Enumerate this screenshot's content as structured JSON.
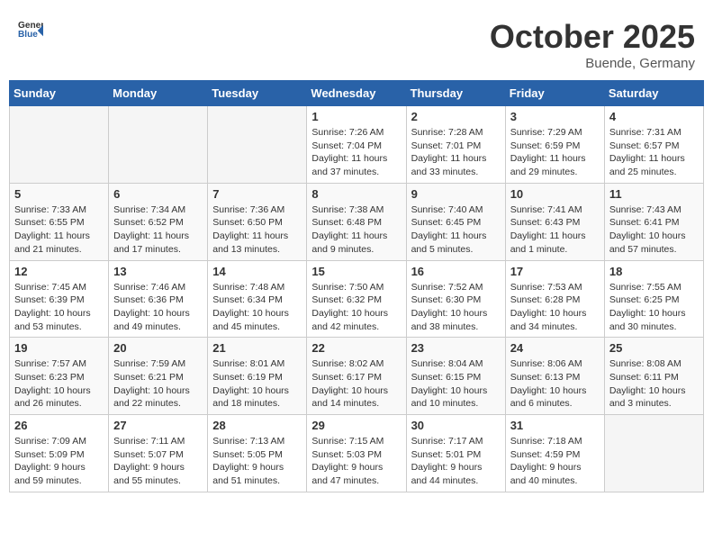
{
  "header": {
    "logo": {
      "general": "General",
      "blue": "Blue"
    },
    "title": "October 2025",
    "location": "Buende, Germany"
  },
  "weekdays": [
    "Sunday",
    "Monday",
    "Tuesday",
    "Wednesday",
    "Thursday",
    "Friday",
    "Saturday"
  ],
  "weeks": [
    [
      {
        "day": "",
        "empty": true
      },
      {
        "day": "",
        "empty": true
      },
      {
        "day": "",
        "empty": true
      },
      {
        "day": "1",
        "sunrise": "7:26 AM",
        "sunset": "7:04 PM",
        "daylight": "11 hours and 37 minutes."
      },
      {
        "day": "2",
        "sunrise": "7:28 AM",
        "sunset": "7:01 PM",
        "daylight": "11 hours and 33 minutes."
      },
      {
        "day": "3",
        "sunrise": "7:29 AM",
        "sunset": "6:59 PM",
        "daylight": "11 hours and 29 minutes."
      },
      {
        "day": "4",
        "sunrise": "7:31 AM",
        "sunset": "6:57 PM",
        "daylight": "11 hours and 25 minutes."
      }
    ],
    [
      {
        "day": "5",
        "sunrise": "7:33 AM",
        "sunset": "6:55 PM",
        "daylight": "11 hours and 21 minutes."
      },
      {
        "day": "6",
        "sunrise": "7:34 AM",
        "sunset": "6:52 PM",
        "daylight": "11 hours and 17 minutes."
      },
      {
        "day": "7",
        "sunrise": "7:36 AM",
        "sunset": "6:50 PM",
        "daylight": "11 hours and 13 minutes."
      },
      {
        "day": "8",
        "sunrise": "7:38 AM",
        "sunset": "6:48 PM",
        "daylight": "11 hours and 9 minutes."
      },
      {
        "day": "9",
        "sunrise": "7:40 AM",
        "sunset": "6:45 PM",
        "daylight": "11 hours and 5 minutes."
      },
      {
        "day": "10",
        "sunrise": "7:41 AM",
        "sunset": "6:43 PM",
        "daylight": "11 hours and 1 minute."
      },
      {
        "day": "11",
        "sunrise": "7:43 AM",
        "sunset": "6:41 PM",
        "daylight": "10 hours and 57 minutes."
      }
    ],
    [
      {
        "day": "12",
        "sunrise": "7:45 AM",
        "sunset": "6:39 PM",
        "daylight": "10 hours and 53 minutes."
      },
      {
        "day": "13",
        "sunrise": "7:46 AM",
        "sunset": "6:36 PM",
        "daylight": "10 hours and 49 minutes."
      },
      {
        "day": "14",
        "sunrise": "7:48 AM",
        "sunset": "6:34 PM",
        "daylight": "10 hours and 45 minutes."
      },
      {
        "day": "15",
        "sunrise": "7:50 AM",
        "sunset": "6:32 PM",
        "daylight": "10 hours and 42 minutes."
      },
      {
        "day": "16",
        "sunrise": "7:52 AM",
        "sunset": "6:30 PM",
        "daylight": "10 hours and 38 minutes."
      },
      {
        "day": "17",
        "sunrise": "7:53 AM",
        "sunset": "6:28 PM",
        "daylight": "10 hours and 34 minutes."
      },
      {
        "day": "18",
        "sunrise": "7:55 AM",
        "sunset": "6:25 PM",
        "daylight": "10 hours and 30 minutes."
      }
    ],
    [
      {
        "day": "19",
        "sunrise": "7:57 AM",
        "sunset": "6:23 PM",
        "daylight": "10 hours and 26 minutes."
      },
      {
        "day": "20",
        "sunrise": "7:59 AM",
        "sunset": "6:21 PM",
        "daylight": "10 hours and 22 minutes."
      },
      {
        "day": "21",
        "sunrise": "8:01 AM",
        "sunset": "6:19 PM",
        "daylight": "10 hours and 18 minutes."
      },
      {
        "day": "22",
        "sunrise": "8:02 AM",
        "sunset": "6:17 PM",
        "daylight": "10 hours and 14 minutes."
      },
      {
        "day": "23",
        "sunrise": "8:04 AM",
        "sunset": "6:15 PM",
        "daylight": "10 hours and 10 minutes."
      },
      {
        "day": "24",
        "sunrise": "8:06 AM",
        "sunset": "6:13 PM",
        "daylight": "10 hours and 6 minutes."
      },
      {
        "day": "25",
        "sunrise": "8:08 AM",
        "sunset": "6:11 PM",
        "daylight": "10 hours and 3 minutes."
      }
    ],
    [
      {
        "day": "26",
        "sunrise": "7:09 AM",
        "sunset": "5:09 PM",
        "daylight": "9 hours and 59 minutes."
      },
      {
        "day": "27",
        "sunrise": "7:11 AM",
        "sunset": "5:07 PM",
        "daylight": "9 hours and 55 minutes."
      },
      {
        "day": "28",
        "sunrise": "7:13 AM",
        "sunset": "5:05 PM",
        "daylight": "9 hours and 51 minutes."
      },
      {
        "day": "29",
        "sunrise": "7:15 AM",
        "sunset": "5:03 PM",
        "daylight": "9 hours and 47 minutes."
      },
      {
        "day": "30",
        "sunrise": "7:17 AM",
        "sunset": "5:01 PM",
        "daylight": "9 hours and 44 minutes."
      },
      {
        "day": "31",
        "sunrise": "7:18 AM",
        "sunset": "4:59 PM",
        "daylight": "9 hours and 40 minutes."
      },
      {
        "day": "",
        "empty": true
      }
    ]
  ],
  "labels": {
    "sunrise": "Sunrise:",
    "sunset": "Sunset:",
    "daylight": "Daylight:"
  }
}
